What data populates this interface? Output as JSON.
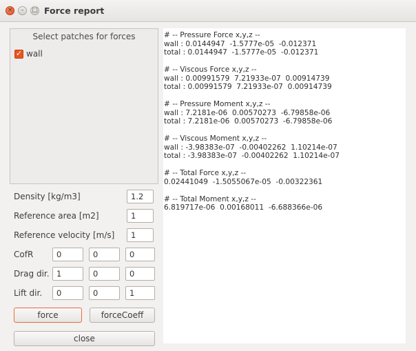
{
  "window": {
    "title": "Force report",
    "close_glyph": "×",
    "min_glyph": "–",
    "max_glyph": "□"
  },
  "patches": {
    "header": "Select patches for forces",
    "items": [
      {
        "label": "wall",
        "checked": true,
        "check_glyph": "✓"
      }
    ]
  },
  "params": {
    "density": {
      "label": "Density [kg/m3]",
      "value": "1.2"
    },
    "ref_area": {
      "label": "Reference area [m2]",
      "value": "1"
    },
    "ref_velocity": {
      "label": "Reference velocity [m/s]",
      "value": "1"
    },
    "cofr": {
      "label": "CofR",
      "values": [
        "0",
        "0",
        "0"
      ]
    },
    "drag_dir": {
      "label": "Drag dir.",
      "values": [
        "1",
        "0",
        "0"
      ]
    },
    "lift_dir": {
      "label": "Lift dir.",
      "values": [
        "0",
        "0",
        "1"
      ]
    }
  },
  "buttons": {
    "force": "force",
    "force_coeff": "forceCoeff",
    "close": "close"
  },
  "output": {
    "lines": [
      "# -- Pressure Force x,y,z --",
      "wall : 0.0144947  -1.5777e-05  -0.012371",
      "total : 0.0144947  -1.5777e-05  -0.012371",
      "",
      "# -- Viscous Force x,y,z --",
      "wall : 0.00991579  7.21933e-07  0.00914739",
      "total : 0.00991579  7.21933e-07  0.00914739",
      "",
      "# -- Pressure Moment x,y,z --",
      "wall : 7.2181e-06  0.00570273  -6.79858e-06",
      "total : 7.2181e-06  0.00570273  -6.79858e-06",
      "",
      "# -- Viscous Moment x,y,z --",
      "wall : -3.98383e-07  -0.00402262  1.10214e-07",
      "total : -3.98383e-07  -0.00402262  1.10214e-07",
      "",
      "# -- Total Force x,y,z --",
      "0.02441049  -1.5055067e-05  -0.00322361",
      "",
      "# -- Total Moment x,y,z --",
      "6.819717e-06  0.00168011  -6.688366e-06"
    ]
  },
  "colors": {
    "accent": "#e95420",
    "window_bg": "#f2f1f0",
    "output_bg": "#ffffff"
  },
  "icons": {
    "close": "close-icon",
    "minimize": "minimize-icon",
    "maximize": "maximize-icon",
    "checkbox": "checkmark-icon"
  }
}
